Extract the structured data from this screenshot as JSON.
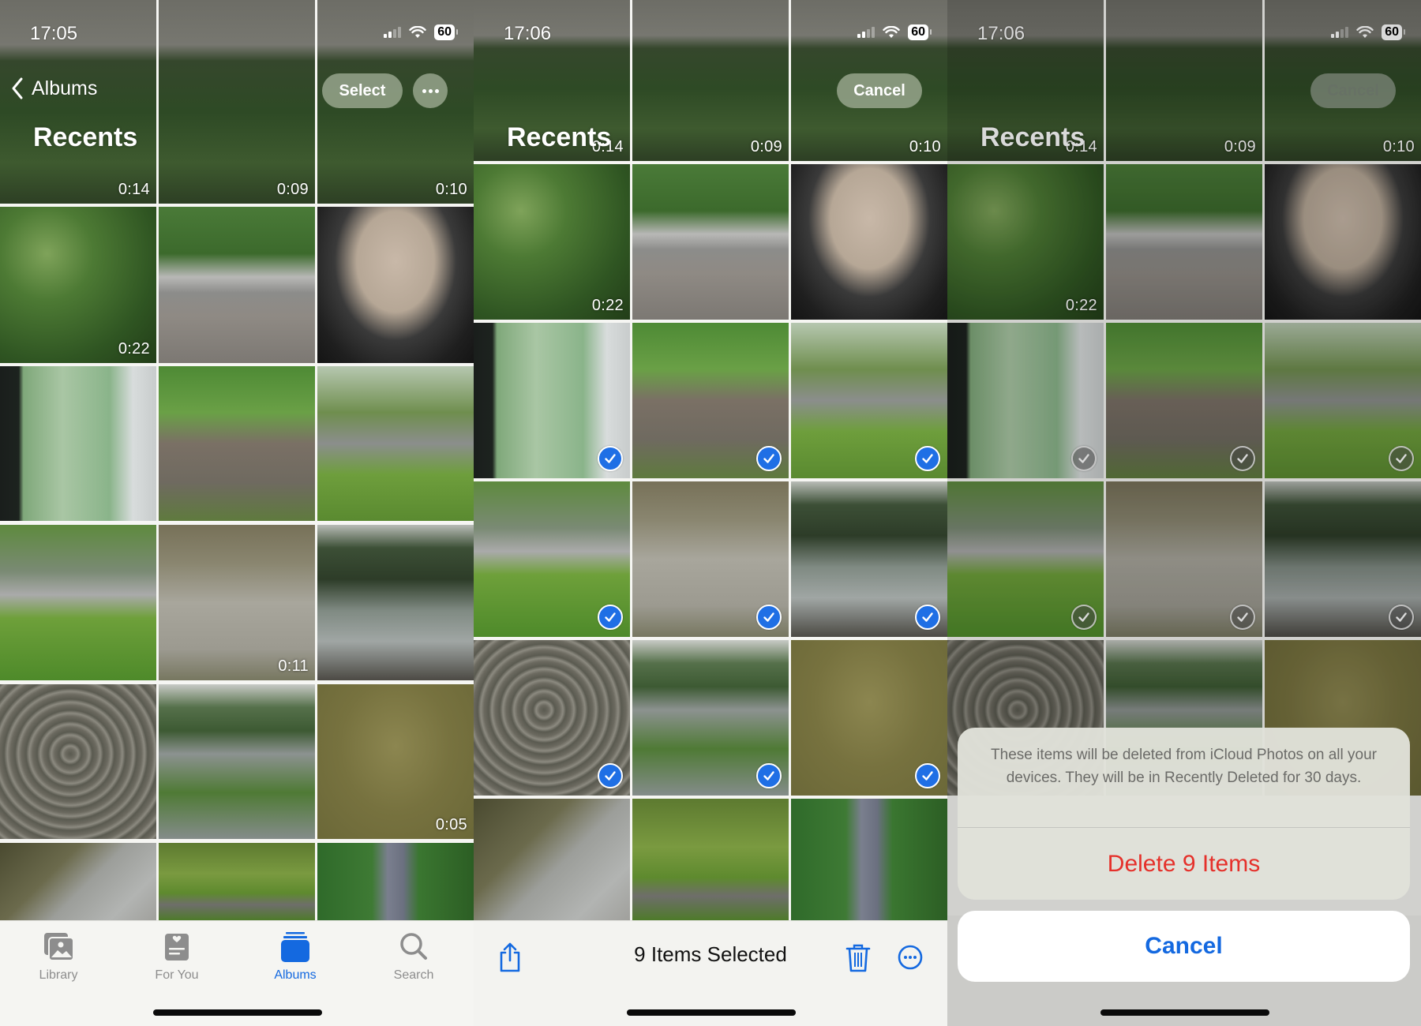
{
  "panels": [
    {
      "status": {
        "time": "17:05",
        "battery": "60",
        "signal_bars_on": 2
      },
      "nav": {
        "back_label": "Albums",
        "title": "Recents",
        "select_label": "Select",
        "more_icon": "ellipsis-icon"
      },
      "tiles": [
        {
          "scene": "trees-top",
          "duration": "0:14"
        },
        {
          "scene": "trees-top",
          "duration": "0:09"
        },
        {
          "scene": "trees-top",
          "duration": "0:10"
        },
        {
          "scene": "trees",
          "duration": "0:22"
        },
        {
          "scene": "car",
          "duration": ""
        },
        {
          "scene": "laptop",
          "duration": ""
        },
        {
          "scene": "window",
          "duration": ""
        },
        {
          "scene": "sign",
          "duration": ""
        },
        {
          "scene": "street",
          "duration": ""
        },
        {
          "scene": "cars-park",
          "duration": ""
        },
        {
          "scene": "pond",
          "duration": "0:11"
        },
        {
          "scene": "pond-trees",
          "duration": ""
        },
        {
          "scene": "ripples",
          "duration": ""
        },
        {
          "scene": "island",
          "duration": ""
        },
        {
          "scene": "olive",
          "duration": "0:05"
        },
        {
          "scene": "dark-pond",
          "duration": ""
        },
        {
          "scene": "willow",
          "duration": ""
        },
        {
          "scene": "path",
          "duration": ""
        }
      ],
      "tabbar": [
        {
          "label": "Library",
          "icon": "photo-library-icon",
          "active": false
        },
        {
          "label": "For You",
          "icon": "for-you-icon",
          "active": false
        },
        {
          "label": "Albums",
          "icon": "albums-icon",
          "active": true
        },
        {
          "label": "Search",
          "icon": "search-icon",
          "active": false
        }
      ]
    },
    {
      "status": {
        "time": "17:06",
        "battery": "60",
        "signal_bars_on": 2
      },
      "nav": {
        "title": "Recents",
        "cancel_label": "Cancel"
      },
      "tiles": [
        {
          "scene": "trees-top",
          "duration": "0:14",
          "selected": false
        },
        {
          "scene": "trees-top",
          "duration": "0:09",
          "selected": false
        },
        {
          "scene": "trees-top",
          "duration": "0:10",
          "selected": false
        },
        {
          "scene": "trees",
          "duration": "0:22",
          "selected": false
        },
        {
          "scene": "car",
          "duration": "",
          "selected": false
        },
        {
          "scene": "laptop",
          "duration": "",
          "selected": false
        },
        {
          "scene": "window",
          "duration": "",
          "selected": true
        },
        {
          "scene": "sign",
          "duration": "",
          "selected": true
        },
        {
          "scene": "street",
          "duration": "",
          "selected": true
        },
        {
          "scene": "cars-park",
          "duration": "",
          "selected": true
        },
        {
          "scene": "pond",
          "duration": "",
          "selected": true
        },
        {
          "scene": "pond-trees",
          "duration": "",
          "selected": true
        },
        {
          "scene": "ripples",
          "duration": "",
          "selected": true
        },
        {
          "scene": "island",
          "duration": "",
          "selected": true
        },
        {
          "scene": "olive",
          "duration": "",
          "selected": true
        },
        {
          "scene": "dark-pond",
          "duration": "",
          "selected": false
        },
        {
          "scene": "willow",
          "duration": "",
          "selected": false
        },
        {
          "scene": "path",
          "duration": "",
          "selected": false
        }
      ],
      "toolbar": {
        "selection_label": "9 Items Selected",
        "share_icon": "share-icon",
        "delete_icon": "trash-icon",
        "more_icon": "ellipsis-circle-icon"
      }
    },
    {
      "status": {
        "time": "17:06",
        "battery": "60",
        "signal_bars_on": 2
      },
      "nav": {
        "title": "Recents",
        "cancel_label": "Cancel"
      },
      "tiles": [
        {
          "scene": "trees-top",
          "duration": "0:14",
          "selected": false
        },
        {
          "scene": "trees-top",
          "duration": "0:09",
          "selected": false
        },
        {
          "scene": "trees-top",
          "duration": "0:10",
          "selected": false
        },
        {
          "scene": "trees",
          "duration": "0:22",
          "selected": false
        },
        {
          "scene": "car",
          "duration": "",
          "selected": false
        },
        {
          "scene": "laptop",
          "duration": "",
          "selected": false
        },
        {
          "scene": "window",
          "duration": "",
          "selected": true
        },
        {
          "scene": "sign",
          "duration": "",
          "selected": true
        },
        {
          "scene": "street",
          "duration": "",
          "selected": true
        },
        {
          "scene": "cars-park",
          "duration": "",
          "selected": true
        },
        {
          "scene": "pond",
          "duration": "",
          "selected": true
        },
        {
          "scene": "pond-trees",
          "duration": "",
          "selected": true
        },
        {
          "scene": "ripples",
          "duration": "",
          "selected": false
        },
        {
          "scene": "island",
          "duration": "",
          "selected": false
        },
        {
          "scene": "olive",
          "duration": "",
          "selected": false
        }
      ],
      "action_sheet": {
        "message": "These items will be deleted from iCloud Photos on all your devices. They will be in Recently Deleted for 30 days.",
        "destructive_label": "Delete 9 Items",
        "cancel_label": "Cancel"
      }
    }
  ],
  "colors": {
    "accent": "#1469e0",
    "destructive": "#e5302a",
    "selected_check": "#1f6fe5"
  }
}
